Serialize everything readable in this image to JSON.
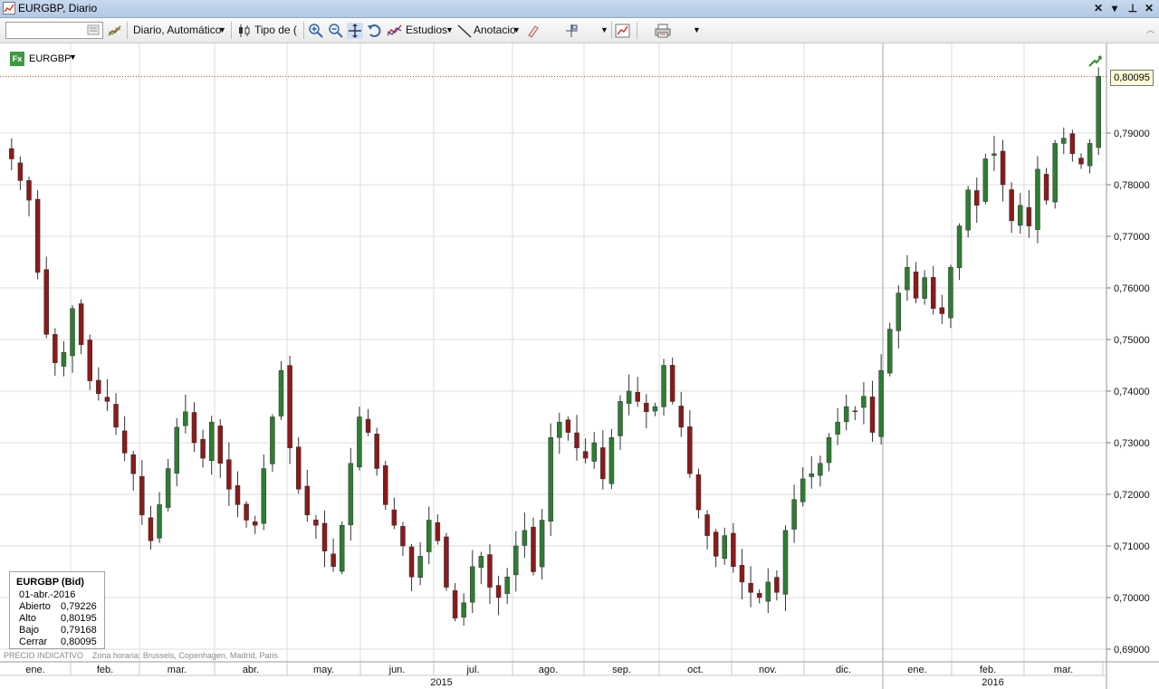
{
  "window": {
    "title": "EURGBP, Diario"
  },
  "toolbar": {
    "symbol_value": "",
    "interval_label": "Diario,  Automático",
    "chart_type_label": "Tipo de (",
    "studies_label": "Estudios",
    "annotation_label": "Anotacio"
  },
  "symbol": {
    "fx_badge": "Fx",
    "name": "EURGBP"
  },
  "last_price": "0,80095",
  "info": {
    "title": "EURGBP (Bid)",
    "date": "01-abr.-2016",
    "open_label": "Abierto",
    "open": "0,79226",
    "high_label": "Alto",
    "high": "0,80195",
    "low_label": "Bajo",
    "low": "0,79168",
    "close_label": "Cerrar",
    "close": "0,80095"
  },
  "footnote": {
    "price_note": "PRECIO INDICATIVO",
    "timezone": "Zona horaria: Brussels, Copenhagen, Madrid, Paris"
  },
  "colors": {
    "up": "#2e7d32",
    "down": "#8b1a1a",
    "grid": "#dedede",
    "last_line": "#c0392b"
  },
  "chart_data": {
    "type": "line",
    "title": "",
    "y_axis_ticks": [
      "0,69000",
      "0,70000",
      "0,71000",
      "0,72000",
      "0,73000",
      "0,74000",
      "0,75000",
      "0,76000",
      "0,77000",
      "0,78000",
      "0,79000"
    ],
    "ylim": [
      0.6868,
      0.8025
    ],
    "x_months": [
      "ene.",
      "feb.",
      "mar.",
      "abr.",
      "may.",
      "jun.",
      "jul.",
      "ago.",
      "sep.",
      "oct.",
      "nov.",
      "dic.",
      "ene.",
      "feb.",
      "mar."
    ],
    "years": [
      "2015",
      "2016"
    ],
    "series": [
      {
        "values": [
          0.785,
          0.7808,
          0.777,
          0.763,
          0.751,
          0.7455,
          0.7475,
          0.756,
          0.749,
          0.742,
          0.7395,
          0.738,
          0.733,
          0.728,
          0.724,
          0.716,
          0.711,
          0.718,
          0.725,
          0.733,
          0.736,
          0.73,
          0.727,
          0.734,
          0.726,
          0.721,
          0.718,
          0.715,
          0.714,
          0.725,
          0.735,
          0.744,
          0.729,
          0.721,
          0.716,
          0.714,
          0.709,
          0.706,
          0.714,
          0.726,
          0.735,
          0.732,
          0.725,
          0.718,
          0.714,
          0.71,
          0.704,
          0.708,
          0.715,
          0.711,
          0.702,
          0.696,
          0.699,
          0.706,
          0.708,
          0.702,
          0.7,
          0.704,
          0.71,
          0.713,
          0.705,
          0.715,
          0.731,
          0.734,
          0.732,
          0.729,
          0.727,
          0.73,
          0.723,
          0.731,
          0.738,
          0.74,
          0.738,
          0.736,
          0.737,
          0.745,
          0.738,
          0.733,
          0.724,
          0.717,
          0.712,
          0.708,
          0.712,
          0.706,
          0.703,
          0.701,
          0.7,
          0.703,
          0.701,
          0.713,
          0.719,
          0.723,
          0.724,
          0.726,
          0.731,
          0.734,
          0.737,
          0.736,
          0.739,
          0.732,
          0.744,
          0.752,
          0.759,
          0.764,
          0.758,
          0.762,
          0.756,
          0.755,
          0.764,
          0.772,
          0.779,
          0.776,
          0.785,
          0.786,
          0.78,
          0.773,
          0.776,
          0.772,
          0.783,
          0.777,
          0.788,
          0.789,
          0.786,
          0.784,
          0.788,
          0.801
        ]
      }
    ]
  }
}
